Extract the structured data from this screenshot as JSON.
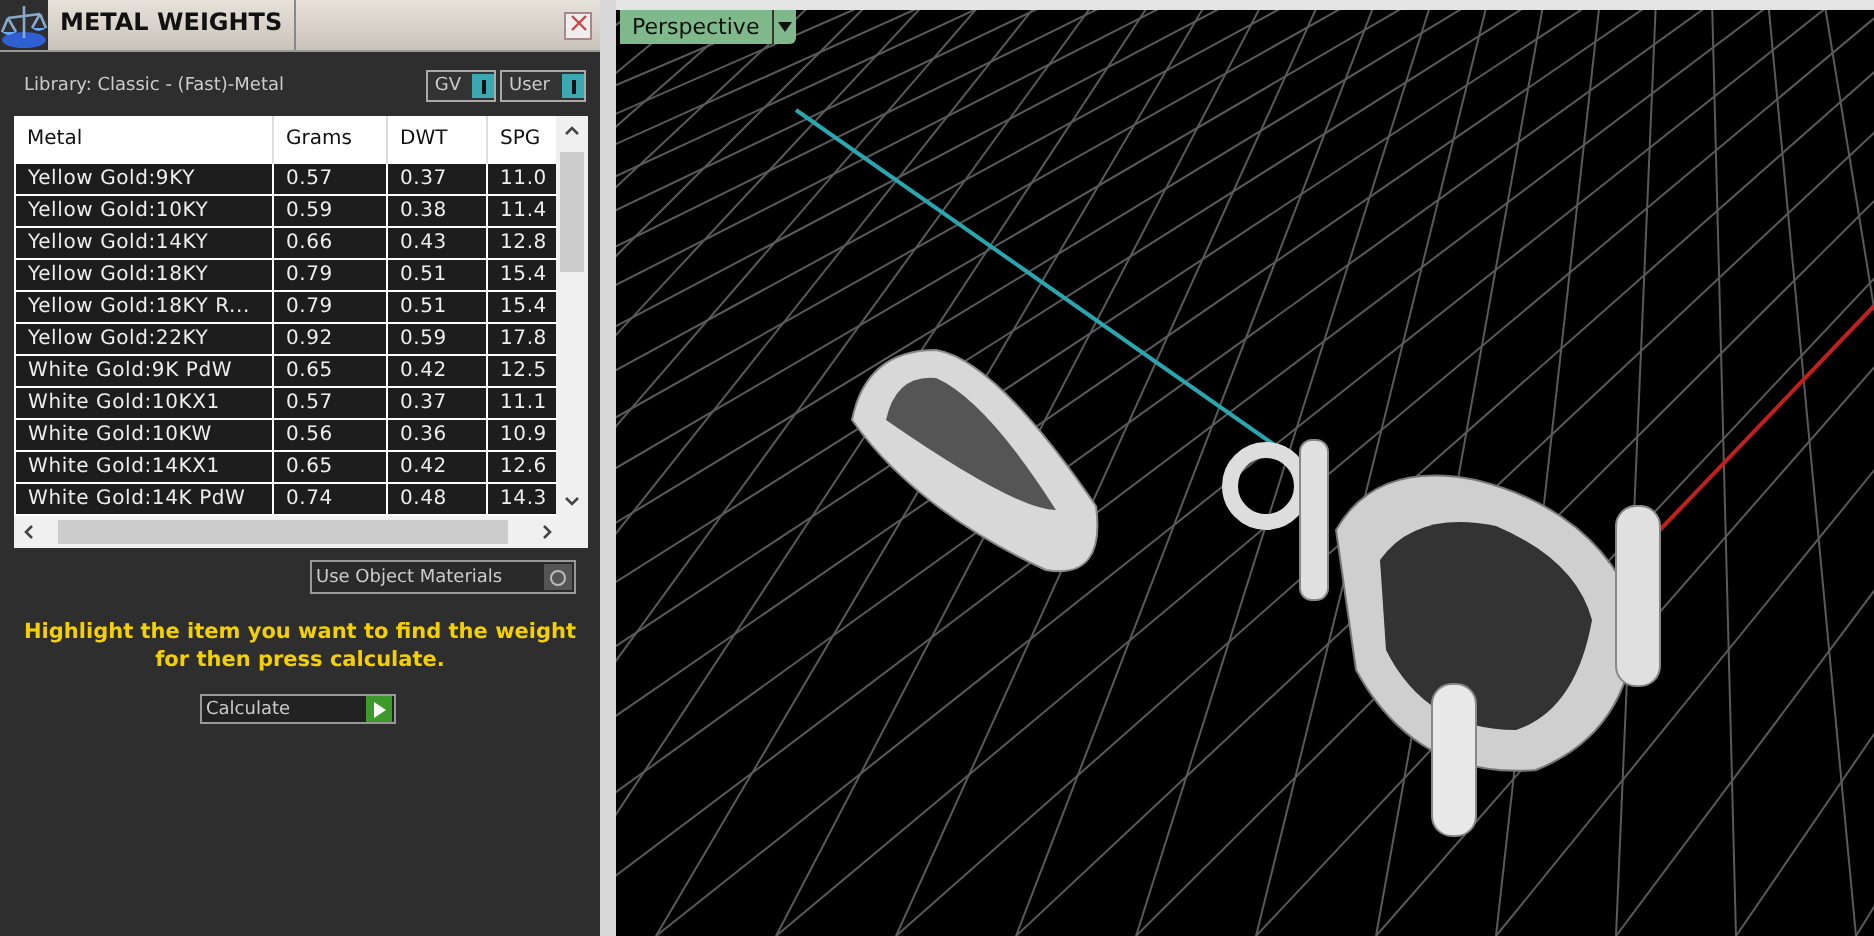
{
  "panel": {
    "title": "METAL WEIGHTS",
    "library": "Library: Classic - (Fast)-Metal",
    "toggles": [
      {
        "label": "GV",
        "on": true
      },
      {
        "label": "User",
        "on": true
      }
    ],
    "table": {
      "columns": [
        "Metal",
        "Grams",
        "DWT",
        "SPG"
      ],
      "rows": [
        [
          "Yellow Gold:9KY",
          "0.57",
          "0.37",
          "11.0"
        ],
        [
          "Yellow Gold:10KY",
          "0.59",
          "0.38",
          "11.4"
        ],
        [
          "Yellow Gold:14KY",
          "0.66",
          "0.43",
          "12.8"
        ],
        [
          "Yellow Gold:18KY",
          "0.79",
          "0.51",
          "15.4"
        ],
        [
          "Yellow Gold:18KY R...",
          "0.79",
          "0.51",
          "15.4"
        ],
        [
          "Yellow Gold:22KY",
          "0.92",
          "0.59",
          "17.8"
        ],
        [
          "White Gold:9K PdW",
          "0.65",
          "0.42",
          "12.5"
        ],
        [
          "White Gold:10KX1",
          "0.57",
          "0.37",
          "11.1"
        ],
        [
          "White Gold:10KW",
          "0.56",
          "0.36",
          "10.9"
        ],
        [
          "White Gold:14KX1",
          "0.65",
          "0.42",
          "12.6"
        ],
        [
          "White Gold:14K PdW",
          "0.74",
          "0.48",
          "14.3"
        ]
      ]
    },
    "option": {
      "label": "Use Object Materials",
      "checked": false
    },
    "hint": "Highlight the item you want to find the weight for then press calculate.",
    "action": "Calculate"
  },
  "viewport": {
    "view": "Perspective"
  }
}
